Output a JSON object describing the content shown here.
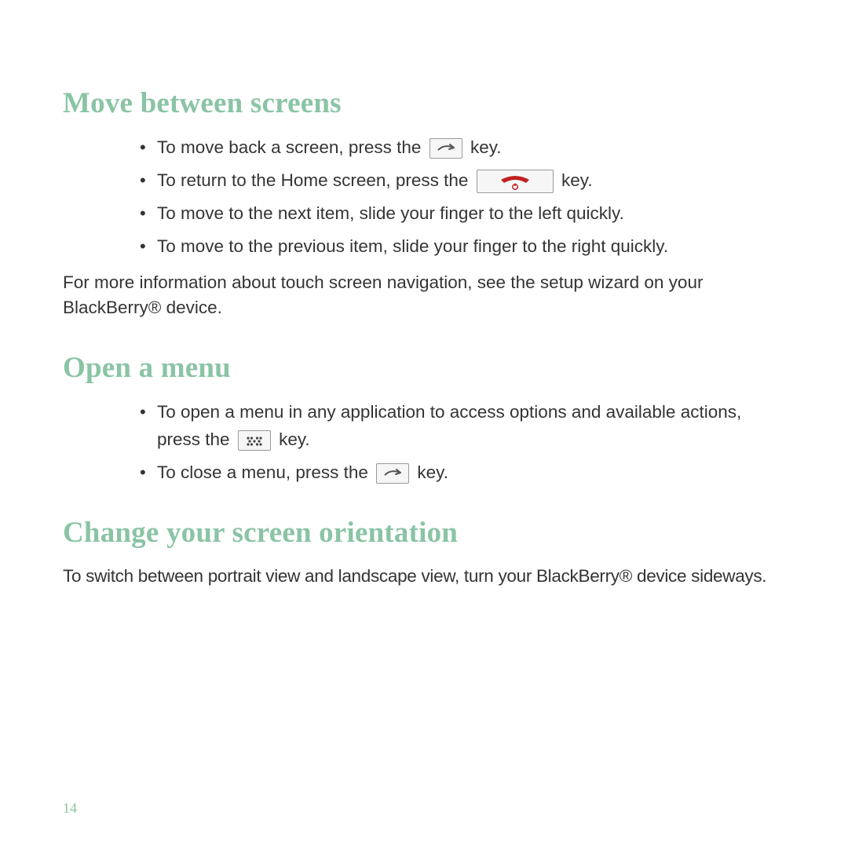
{
  "section1": {
    "heading": "Move between screens",
    "items": [
      {
        "before": "To move back a screen, press the",
        "after": "key."
      },
      {
        "before": "To return to the Home screen, press the",
        "after": "key."
      },
      {
        "full": "To move to the next item, slide your finger to the left quickly."
      },
      {
        "full": "To move to the previous item, slide your finger to the right quickly."
      }
    ],
    "para": "For more information about touch screen navigation, see the setup wizard on your BlackBerry® device."
  },
  "section2": {
    "heading": "Open a menu",
    "items": [
      {
        "before": "To open a menu in any application to access options and available actions, press the",
        "after": "key."
      },
      {
        "before": "To close a menu, press the",
        "after": "key."
      }
    ]
  },
  "section3": {
    "heading": "Change your screen orientation",
    "para": "To switch between portrait view and landscape view, turn your BlackBerry® device sideways."
  },
  "pageNumber": "14"
}
